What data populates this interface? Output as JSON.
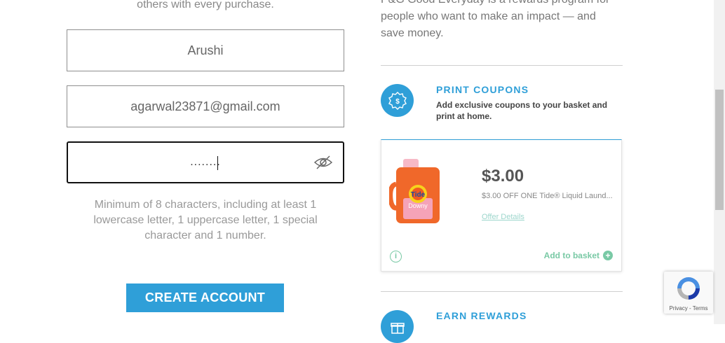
{
  "left": {
    "intro_tail": "others with every purchase.",
    "name_field": {
      "value": "Arushi"
    },
    "email_field": {
      "value": "agarwal23871@gmail.com"
    },
    "password_field": {
      "value": "........"
    },
    "password_hint": "Minimum of 8 characters, including at least 1 lowercase letter, 1 uppercase letter, 1 special character and 1 number.",
    "create_button_label": "CREATE ACCOUNT"
  },
  "right": {
    "program_text": "P&G Good Everyday is a rewards program for people who want to make an impact — and save money.",
    "print_coupons": {
      "title": "PRINT COUPONS",
      "description": "Add exclusive coupons to your basket and print at home.",
      "icon": "dollar-badge-icon"
    },
    "coupon": {
      "price": "$3.00",
      "description": "$3.00 OFF ONE Tide® Liquid Laund...",
      "offer_link": "Offer Details",
      "add_label": "Add to basket",
      "product_brand": "Tide",
      "product_sub": "Downy"
    },
    "earn_rewards": {
      "title": "EARN REWARDS",
      "icon": "gift-icon"
    }
  },
  "recaptcha": {
    "links": "Privacy - Terms"
  },
  "colors": {
    "accent": "#2f9fd8",
    "green": "#79c9a5",
    "tide_orange": "#f0682a"
  }
}
